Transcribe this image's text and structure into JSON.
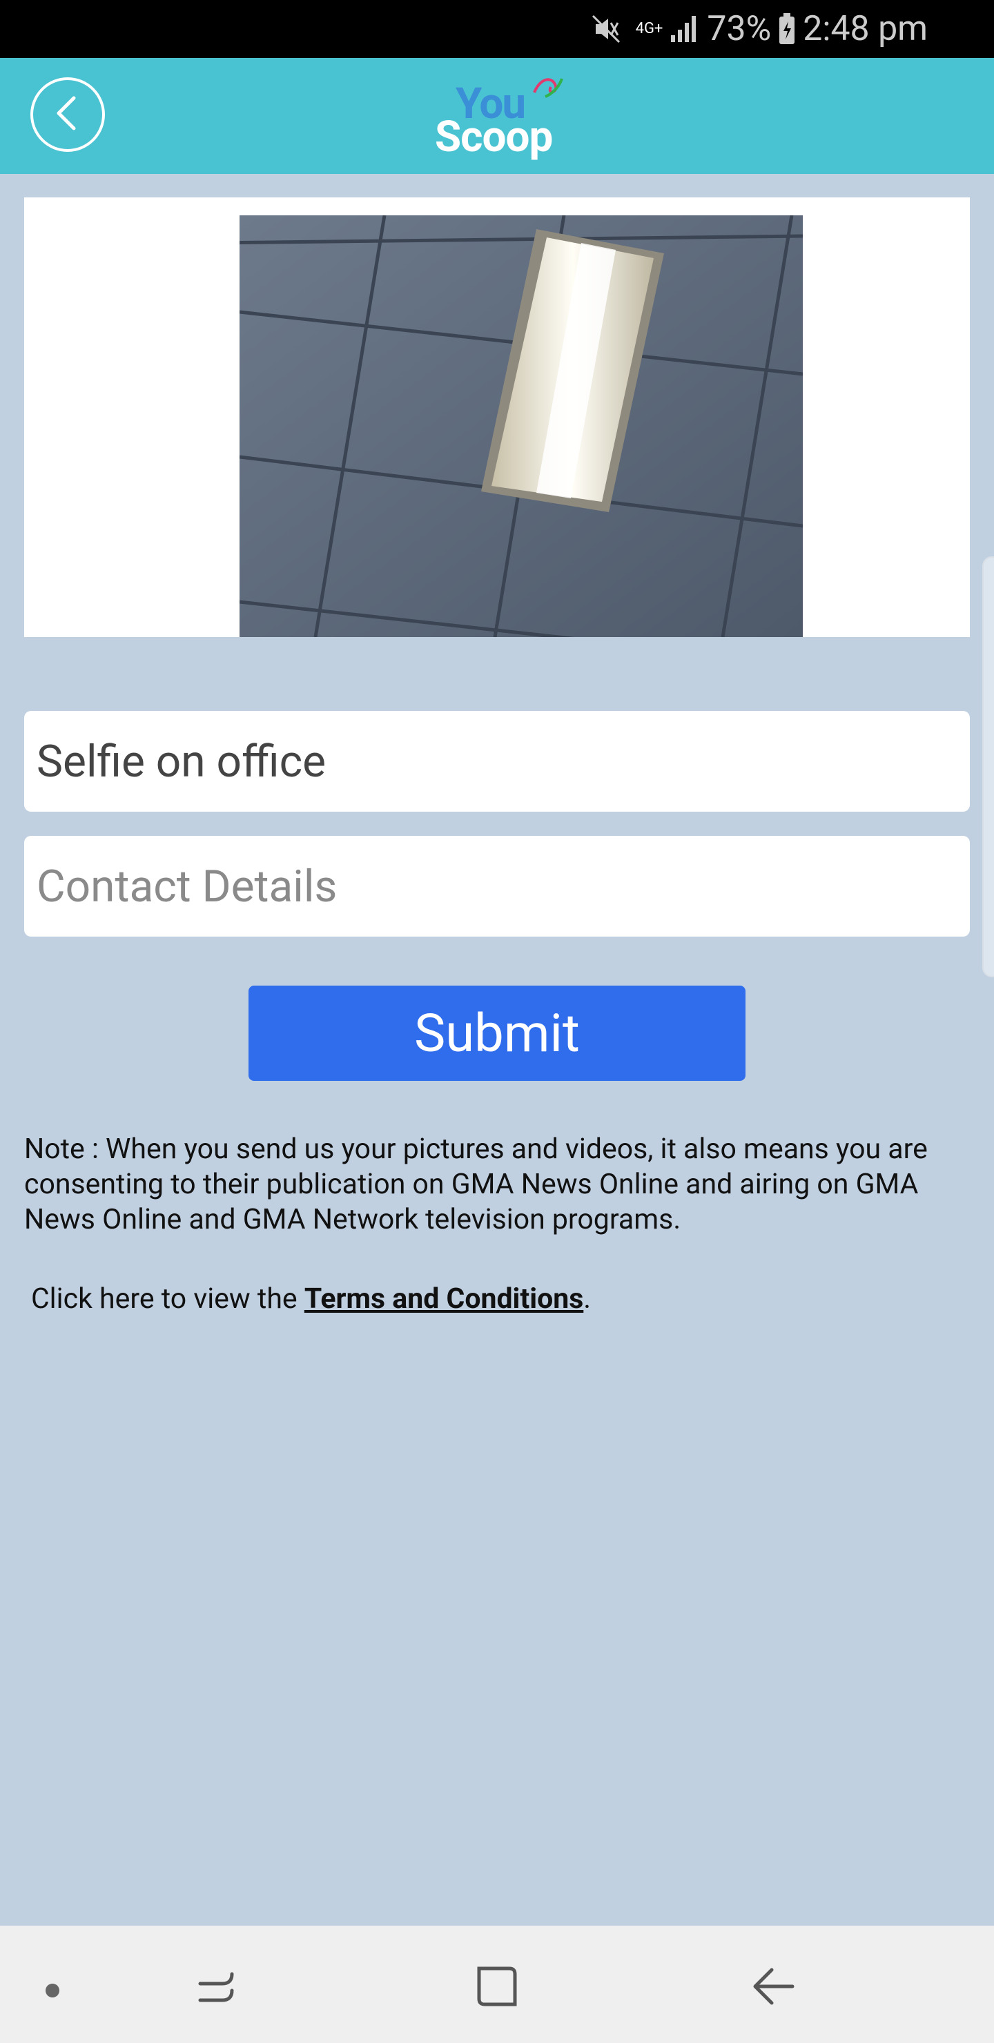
{
  "status_bar": {
    "network": "4G+",
    "battery": "73%",
    "time": "2:48 pm"
  },
  "app_bar": {
    "logo_top": "You",
    "logo_bottom": "Scoop",
    "back_icon": "chevron-left-icon"
  },
  "form": {
    "title_value": "Selfie on office",
    "contact_placeholder": "Contact Details",
    "submit_label": "Submit"
  },
  "note": "Note : When you send us your pictures and videos, it also means you are consenting to their publication on GMA News Online and airing on GMA News Online and GMA Network television programs.",
  "terms": {
    "prefix": "Click here to view the ",
    "link": "Terms and Conditions",
    "suffix": "."
  },
  "colors": {
    "app_bar": "#49c2d2",
    "background": "#c0d0e1",
    "submit": "#2f6ded"
  }
}
